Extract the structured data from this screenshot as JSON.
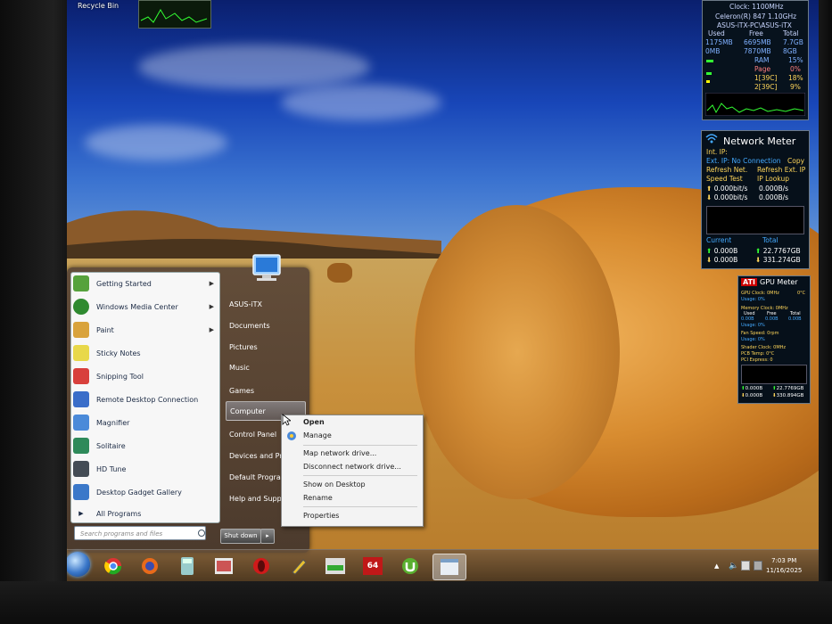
{
  "desktop": {
    "recycle_bin_label": "Recycle Bin"
  },
  "start_menu": {
    "programs": [
      {
        "label": "Getting Started",
        "has_submenu": true,
        "color": "#56a23c"
      },
      {
        "label": "Windows Media Center",
        "has_submenu": true,
        "color": "#2f8a30"
      },
      {
        "label": "Paint",
        "has_submenu": true,
        "color": "#d9a33c"
      },
      {
        "label": "Sticky Notes",
        "has_submenu": false,
        "color": "#e8d84a"
      },
      {
        "label": "Snipping Tool",
        "has_submenu": false,
        "color": "#d8403c"
      },
      {
        "label": "Remote Desktop Connection",
        "has_submenu": false,
        "color": "#3a6ec9"
      },
      {
        "label": "Magnifier",
        "has_submenu": false,
        "color": "#4a8ad9"
      },
      {
        "label": "Solitaire",
        "has_submenu": false,
        "color": "#2e8a5a"
      },
      {
        "label": "HD Tune",
        "has_submenu": false,
        "color": "#444c55"
      },
      {
        "label": "Desktop Gadget Gallery",
        "has_submenu": false,
        "color": "#3a78c9"
      }
    ],
    "all_programs": "All Programs",
    "search_placeholder": "Search programs and files",
    "right_items": [
      {
        "label": "ASUS-iTX",
        "highlighted": false
      },
      {
        "label": "Documents",
        "highlighted": false
      },
      {
        "label": "Pictures",
        "highlighted": false
      },
      {
        "label": "Music",
        "highlighted": false
      },
      {
        "label": "Games",
        "highlighted": false
      },
      {
        "label": "Computer",
        "highlighted": true
      },
      {
        "label": "Control Panel",
        "highlighted": false
      },
      {
        "label": "Devices and Printers",
        "highlighted": false
      },
      {
        "label": "Default Programs",
        "highlighted": false
      },
      {
        "label": "Help and Support",
        "highlighted": false
      }
    ],
    "shutdown_label": "Shut down"
  },
  "context_menu": {
    "open": "Open",
    "manage": "Manage",
    "map_drive": "Map network drive...",
    "disconnect_drive": "Disconnect network drive...",
    "show_on_desktop": "Show on Desktop",
    "rename": "Rename",
    "properties": "Properties"
  },
  "cpu_gadget": {
    "clock": "Clock: 1100MHz",
    "cpu_name": "Celeron(R) 847 1.10GHz",
    "host": "ASUS-iTX-PC\\ASUS-iTX",
    "header_used": "Used",
    "header_free": "Free",
    "header_total": "Total",
    "row1": [
      "1175MB",
      "6695MB",
      "7.7GB"
    ],
    "row2": [
      "0MB",
      "7870MB",
      "8GB"
    ],
    "ram_label": "RAM",
    "ram_value": "15%",
    "page_label": "Page",
    "page_value": "0%",
    "core1_label": "1[39C]",
    "core1_value": "18%",
    "core2_label": "2[39C]",
    "core2_value": "9%"
  },
  "network_gadget": {
    "title": "Network Meter",
    "int_ip": "Int. IP:",
    "ext_ip": "Ext. IP: No Connection",
    "copy": "Copy",
    "refresh_net": "Refresh Net.",
    "refresh_ext": "Refresh Ext. IP",
    "speed_test": "Speed Test",
    "ip_lookup": "IP Lookup",
    "up_rate": "0.000bit/s",
    "up_bytes": "0.000B/s",
    "down_rate": "0.000bit/s",
    "down_bytes": "0.000B/s",
    "current_label": "Current",
    "total_label": "Total",
    "cur_up": "0.000B",
    "cur_down": "0.000B",
    "total_up": "22.7767GB",
    "total_down": "331.274GB"
  },
  "gpu_gadget": {
    "brand": "ATI",
    "title": "GPU Meter",
    "gpu_clock": "GPU Clock: 0MHz",
    "gpu_temp": "0°C",
    "usage1": "Usage: 0%",
    "mem_clock": "Memory Clock: 0MHz",
    "mem_used": "Used",
    "mem_free": "Free",
    "mem_total": "Total",
    "mem_vals": [
      "0.00B",
      "0.00B",
      "0.00B"
    ],
    "usage2": "Usage: 0%",
    "fan": "Fan Speed: 0rpm",
    "usage3": "Usage: 0%",
    "shader": "Shader Clock: 0MHz",
    "pcb_temp": "PCB Temp: 0°C",
    "pci": "PCI Express: 0",
    "up": "0.000B",
    "up_total": "22.7769GB",
    "down": "0.000B",
    "down_total": "330.894GB"
  },
  "taskbar": {
    "apps": [
      "chrome-icon",
      "firefox-icon",
      "calculator-icon",
      "gallery-icon",
      "opera-icon",
      "pencil-icon",
      "network-icon",
      "aida64-icon",
      "utorrent-icon",
      "notepad-icon"
    ],
    "aida_label": "64",
    "time": "7:03 PM",
    "date": "11/16/2025"
  }
}
